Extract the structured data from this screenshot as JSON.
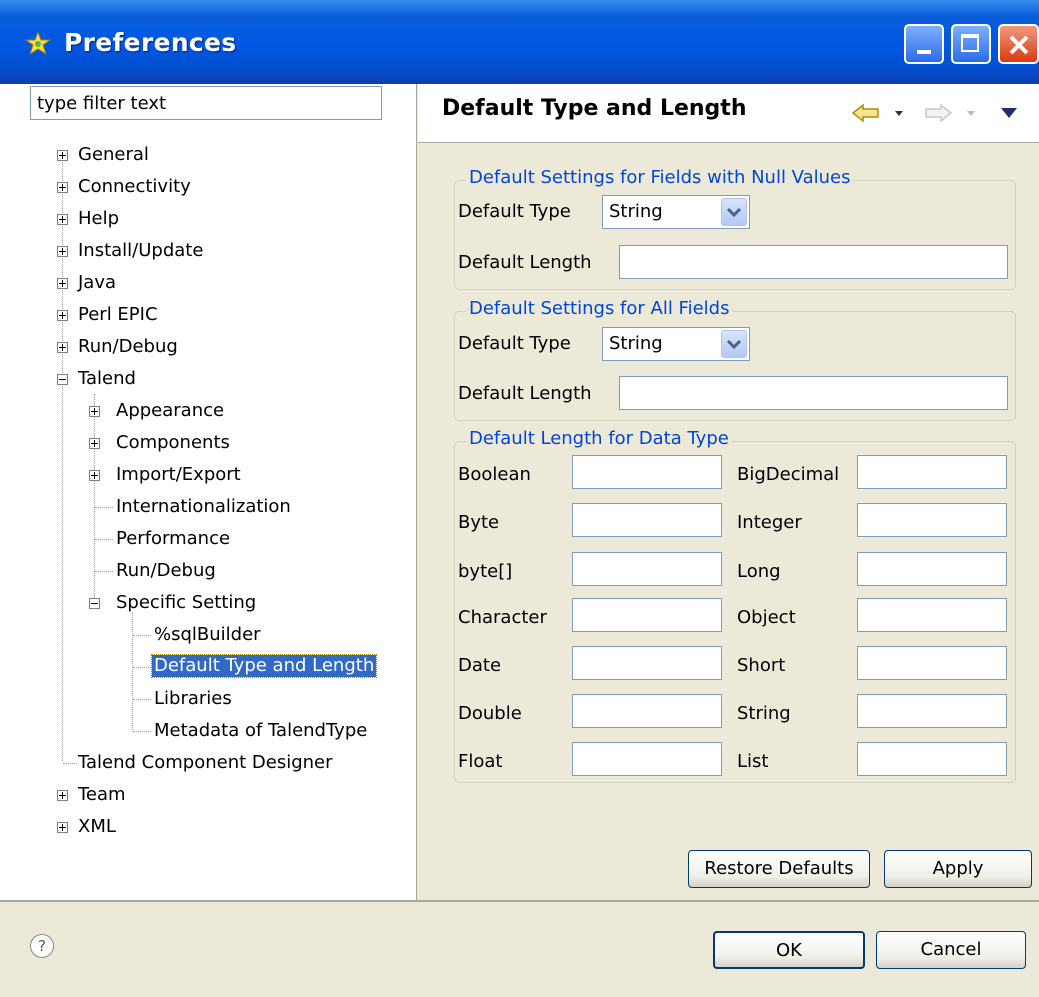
{
  "window": {
    "title": "Preferences"
  },
  "filter": {
    "placeholder": "type filter text"
  },
  "tree": [
    {
      "label": "General",
      "expandable": true
    },
    {
      "label": "Connectivity",
      "expandable": true
    },
    {
      "label": "Help",
      "expandable": true
    },
    {
      "label": "Install/Update",
      "expandable": true
    },
    {
      "label": "Java",
      "expandable": true
    },
    {
      "label": "Perl EPIC",
      "expandable": true
    },
    {
      "label": "Run/Debug",
      "expandable": true
    },
    {
      "label": "Talend",
      "expanded": true
    },
    {
      "label": "Appearance",
      "expandable": true
    },
    {
      "label": "Components",
      "expandable": true
    },
    {
      "label": "Import/Export",
      "expandable": true
    },
    {
      "label": "Internationalization"
    },
    {
      "label": "Performance"
    },
    {
      "label": "Run/Debug"
    },
    {
      "label": "Specific Setting",
      "expanded": true
    },
    {
      "label": "%sqlBuilder"
    },
    {
      "label": "Default Type and Length",
      "selected": true
    },
    {
      "label": "Libraries"
    },
    {
      "label": "Metadata of TalendType"
    },
    {
      "label": "Talend Component Designer"
    },
    {
      "label": "Team",
      "expandable": true
    },
    {
      "label": "XML",
      "expandable": true
    }
  ],
  "page": {
    "title": "Default Type and Length"
  },
  "null_group": {
    "title": "Default Settings for Fields with Null Values",
    "type_label": "Default Type",
    "type_value": "String",
    "length_label": "Default Length",
    "length_value": ""
  },
  "all_group": {
    "title": "Default Settings for All Fields",
    "type_label": "Default Type",
    "type_value": "String",
    "length_label": "Default Length",
    "length_value": ""
  },
  "datatype_group": {
    "title": "Default Length for Data Type",
    "left": [
      "Boolean",
      "Byte",
      "byte[]",
      "Character",
      "Date",
      "Double",
      "Float"
    ],
    "right": [
      "BigDecimal",
      "Integer",
      "Long",
      "Object",
      "Short",
      "String",
      "List"
    ]
  },
  "buttons": {
    "restore": "Restore Defaults",
    "apply": "Apply",
    "ok": "OK",
    "cancel": "Cancel"
  },
  "icons": {
    "app": "preferences-icon",
    "back": "back-arrow-icon",
    "forward": "forward-arrow-icon",
    "menu": "view-menu-icon",
    "help": "help-icon"
  }
}
